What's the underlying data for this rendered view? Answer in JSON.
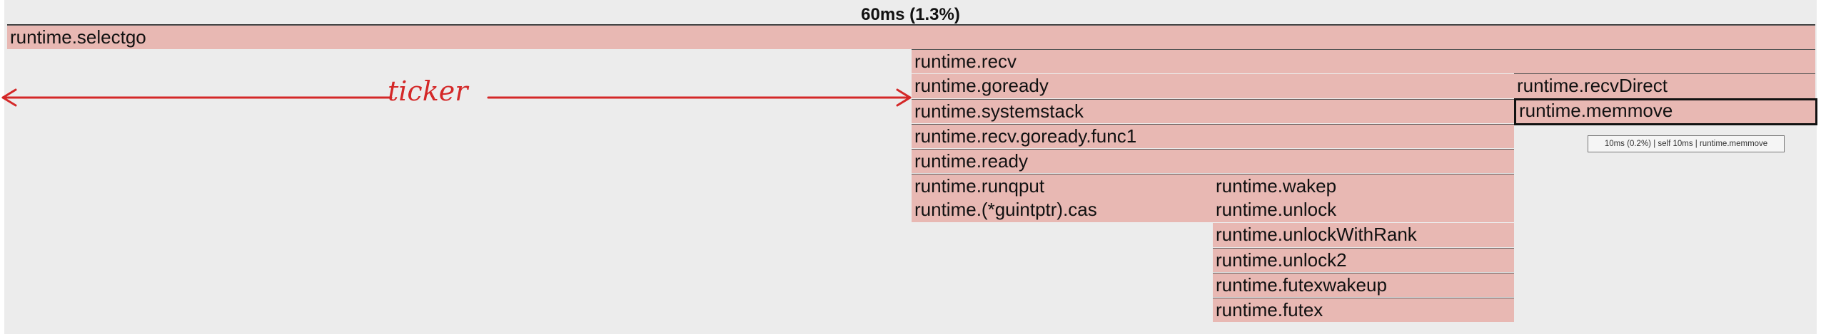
{
  "header": {
    "title": "60ms (1.3%)"
  },
  "frames": {
    "selectgo": "runtime.selectgo",
    "recv": "runtime.recv",
    "goready": "runtime.goready",
    "recvDirect": "runtime.recvDirect",
    "systemstack": "runtime.systemstack",
    "memmove": "runtime.memmove",
    "goready_func1": "runtime.recv.goready.func1",
    "ready": "runtime.ready",
    "runqput": "runtime.runqput",
    "guintptr_cas": "runtime.(*guintptr).cas",
    "wakep": "runtime.wakep",
    "unlock": "runtime.unlock",
    "unlockWithRank": "runtime.unlockWithRank",
    "unlock2": "runtime.unlock2",
    "futexwakeup": "runtime.futexwakeup",
    "futex": "runtime.futex"
  },
  "tooltip": {
    "text": "10ms (0.2%)  |  self 10ms  |  runtime.memmove"
  },
  "annotation": {
    "label": "ticker",
    "color": "#d42828"
  },
  "colors": {
    "frame": "#e8b8b3",
    "background": "#ececec",
    "annotation": "#d42828"
  }
}
